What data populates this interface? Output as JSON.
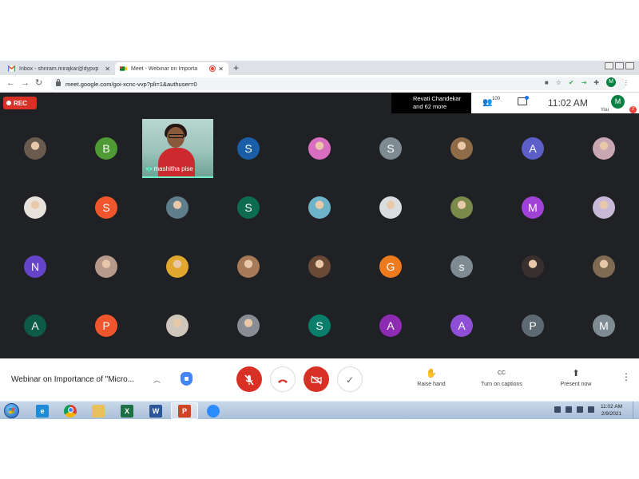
{
  "browser": {
    "tabs": [
      {
        "title": "Inbox - shriram.mirajkar@dypvp",
        "close": "✕"
      },
      {
        "title": "Meet - Webinar on Importa",
        "close": "✕"
      }
    ],
    "new_tab": "+",
    "url": "meet.google.com/goi-xcnc-vvp?pli=1&authuser=0",
    "profile_initial": "M"
  },
  "meet": {
    "rec_label": "REC",
    "active_speaker": {
      "name": "Revati Chandekar",
      "more": "and 62 more"
    },
    "participants_count": "100",
    "clock": "11:02 AM",
    "self": {
      "initial": "M",
      "label": "You"
    },
    "notification_count": "2",
    "video_tile": {
      "name": "mashitha pise"
    },
    "grid": [
      {
        "initial": "",
        "color": "#6b5a4e",
        "photo": true
      },
      {
        "initial": "B",
        "color": "#4f9a35"
      },
      {
        "initial": "S",
        "color": "#1a5ea8"
      },
      {
        "initial": "",
        "color": "#d96ec0",
        "photo": true
      },
      {
        "initial": "S",
        "color": "#7e8b93"
      },
      {
        "initial": "",
        "color": "#8f6b47",
        "photo": true
      },
      {
        "initial": "A",
        "color": "#5b5fc7"
      },
      {
        "initial": "",
        "color": "#c9a7b2",
        "photo": true
      },
      {
        "initial": "",
        "color": "#e7e2dc",
        "photo": true
      },
      {
        "initial": "S",
        "color": "#f0562e"
      },
      {
        "initial": "",
        "color": "#607d8b",
        "photo": true
      },
      {
        "initial": "S",
        "color": "#0d6b4f"
      },
      {
        "initial": "",
        "color": "#6fb3c9",
        "photo": true
      },
      {
        "initial": "",
        "color": "#d9dde0",
        "photo": true
      },
      {
        "initial": "",
        "color": "#7a8a4a",
        "photo": true
      },
      {
        "initial": "M",
        "color": "#a142d6"
      },
      {
        "initial": "",
        "color": "#c8b9d9",
        "photo": true
      },
      {
        "initial": "N",
        "color": "#6544c9"
      },
      {
        "initial": "",
        "color": "#b89a8c",
        "photo": true
      },
      {
        "initial": "",
        "color": "#e0a82e",
        "photo": true
      },
      {
        "initial": "",
        "color": "#a87a57",
        "photo": true
      },
      {
        "initial": "",
        "color": "#6b4a35",
        "photo": true
      },
      {
        "initial": "G",
        "color": "#ee7a1e"
      },
      {
        "initial": "s",
        "color": "#7e8b93"
      },
      {
        "initial": "",
        "color": "#3a2f2f",
        "photo": true
      },
      {
        "initial": "",
        "color": "#7f6a53",
        "photo": true
      },
      {
        "initial": "A",
        "color": "#0d5a47"
      },
      {
        "initial": "P",
        "color": "#f0562e"
      },
      {
        "initial": "",
        "color": "#cfc7bb",
        "photo": true
      },
      {
        "initial": "",
        "color": "#8a8c93",
        "photo": true
      },
      {
        "initial": "S",
        "color": "#0b7d6b"
      },
      {
        "initial": "A",
        "color": "#8e2bb3"
      },
      {
        "initial": "A",
        "color": "#8e4fd6"
      },
      {
        "initial": "P",
        "color": "#5e6a73"
      },
      {
        "initial": "M",
        "color": "#7e8b93"
      }
    ],
    "bottom": {
      "meeting_title": "Webinar on Importance of \"Micro...",
      "actions": [
        {
          "icon": "✋",
          "label": "Raise hand"
        },
        {
          "icon": "CC",
          "label": "Turn on captions"
        },
        {
          "icon": "⬆",
          "label": "Present now"
        }
      ]
    }
  },
  "taskbar": {
    "time": "11:02 AM",
    "date": "2/9/2021",
    "apps": [
      {
        "name": "internet-explorer",
        "glyph": "e",
        "color": "#1e8bd6"
      },
      {
        "name": "chrome",
        "glyph": "",
        "color": "#dd4b39"
      },
      {
        "name": "file-explorer",
        "glyph": "",
        "color": "#e8c15a"
      },
      {
        "name": "excel",
        "glyph": "X",
        "color": "#1d7044"
      },
      {
        "name": "word",
        "glyph": "W",
        "color": "#2b5797"
      },
      {
        "name": "powerpoint",
        "glyph": "P",
        "color": "#d04423"
      },
      {
        "name": "zoom",
        "glyph": "",
        "color": "#2d8cff"
      }
    ]
  }
}
